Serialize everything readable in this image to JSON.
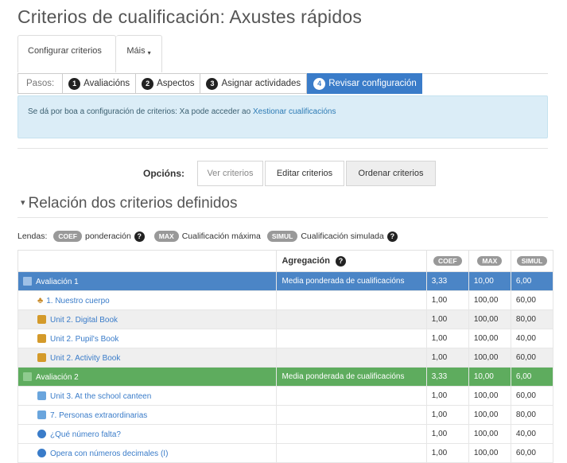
{
  "page": {
    "title": "Criterios de cualificación: Axustes rápidos"
  },
  "tabs": {
    "configurar": "Configurar criterios",
    "mais": "Máis",
    "caret": "▾"
  },
  "steps": {
    "label": "Pasos:",
    "items": [
      {
        "num": "1",
        "label": "Avaliacións"
      },
      {
        "num": "2",
        "label": "Aspectos"
      },
      {
        "num": "3",
        "label": "Asignar actividades"
      },
      {
        "num": "4",
        "label": "Revisar configuración"
      }
    ]
  },
  "alert": {
    "text": "Se dá por boa a configuración de criterios: Xa pode acceder ao ",
    "link": "Xestionar cualificacións"
  },
  "options": {
    "label": "Opcións:",
    "ver": "Ver criterios",
    "editar": "Editar criterios",
    "ordenar": "Ordenar criterios"
  },
  "section": {
    "title": "Relación dos criterios definidos",
    "tri": "▾"
  },
  "legend": {
    "label": "Lendas:",
    "coef_pill": "COEF",
    "coef_text": "ponderación",
    "max_pill": "MAX",
    "max_text": "Cualificación máxima",
    "simul_pill": "SIMUL",
    "simul_text": "Cualificación simulada",
    "help": "?"
  },
  "table": {
    "headers": {
      "agregacion": "Agregación",
      "coef": "COEF",
      "max": "MAX",
      "simul": "SIMUL",
      "help": "?"
    },
    "rows": [
      {
        "name": "Avaliación 1",
        "agg": "Media ponderada de cualificacións",
        "coef": "3,33",
        "max": "10,00",
        "simul": "6,00"
      },
      {
        "name": "1. Nuestro cuerpo",
        "agg": "",
        "coef": "1,00",
        "max": "100,00",
        "simul": "60,00"
      },
      {
        "name": "Unit 2. Digital Book",
        "agg": "",
        "coef": "1,00",
        "max": "100,00",
        "simul": "80,00"
      },
      {
        "name": "Unit 2. Pupil's Book",
        "agg": "",
        "coef": "1,00",
        "max": "100,00",
        "simul": "40,00"
      },
      {
        "name": "Unit 2. Activity Book",
        "agg": "",
        "coef": "1,00",
        "max": "100,00",
        "simul": "60,00"
      },
      {
        "name": "Avaliación 2",
        "agg": "Media ponderada de cualificacións",
        "coef": "3,33",
        "max": "10,00",
        "simul": "6,00"
      },
      {
        "name": "Unit 3. At the school canteen",
        "agg": "",
        "coef": "1,00",
        "max": "100,00",
        "simul": "60,00"
      },
      {
        "name": "7. Personas extraordinarias",
        "agg": "",
        "coef": "1,00",
        "max": "100,00",
        "simul": "80,00"
      },
      {
        "name": "¿Qué número falta?",
        "agg": "",
        "coef": "1,00",
        "max": "100,00",
        "simul": "40,00"
      },
      {
        "name": "Opera con números decimales (I)",
        "agg": "",
        "coef": "1,00",
        "max": "100,00",
        "simul": "60,00"
      }
    ]
  }
}
